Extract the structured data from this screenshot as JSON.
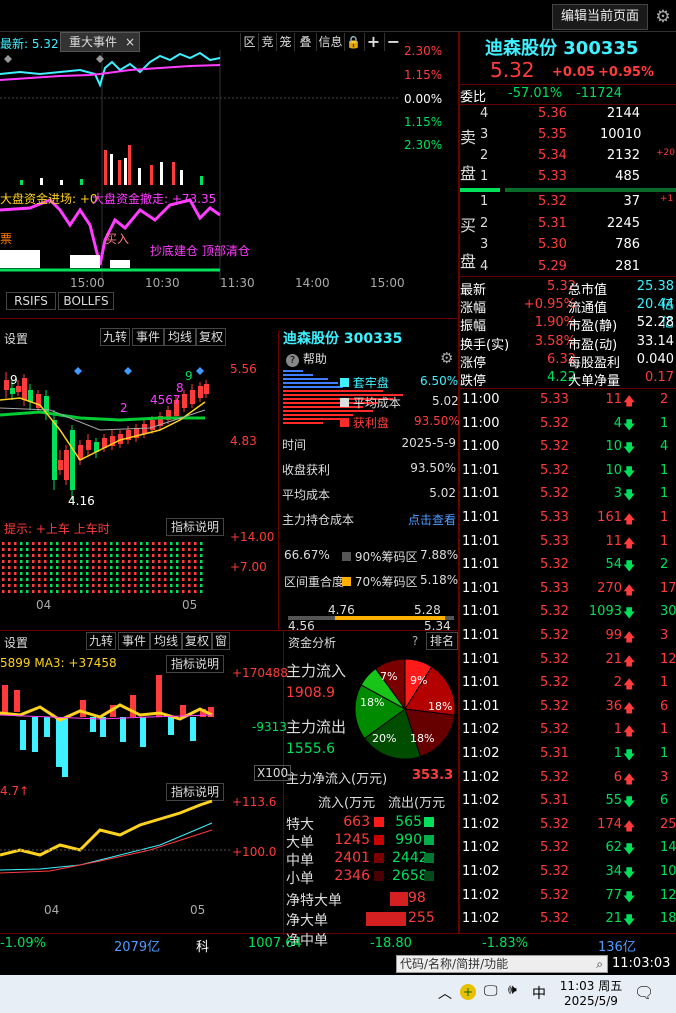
{
  "top": {
    "edit_label": "编辑当前页面"
  },
  "event_tab": {
    "prefix": "最新: 5.32",
    "label": "重大事件",
    "close": "×"
  },
  "chart_toolbar": [
    "区",
    "竞",
    "笼",
    "叠",
    "信息",
    "🔒"
  ],
  "pct_axis": [
    "2.30%",
    "1.15%",
    "0.00%",
    "1.15%",
    "2.30%"
  ],
  "flow_text": {
    "in": "大盘资金进场: +0",
    "out": "大盘资金撤走: +73.35"
  },
  "misc_text": {
    "piao": "票",
    "bottom_line": "抄底建仓  顶部清仓",
    "buy_mark": "买入"
  },
  "time_axis": [
    "15:00",
    "10:30",
    "11:30",
    "14:00",
    "15:00"
  ],
  "indicator_tabs": [
    "RSIFS",
    "BOLLFS"
  ],
  "stock": {
    "name": "迪森股份",
    "code": "300335",
    "price": "5.32",
    "change": "+0.05",
    "change_pct": "+0.95%"
  },
  "weibi": {
    "label": "委比",
    "pct": "-57.01%",
    "diff": "-11724"
  },
  "sell": {
    "label": [
      "卖",
      "盘"
    ],
    "rows": [
      {
        "n": "4",
        "p": "5.36",
        "v": "2144",
        "x": ""
      },
      {
        "n": "3",
        "p": "5.35",
        "v": "10010",
        "x": ""
      },
      {
        "n": "2",
        "p": "5.34",
        "v": "2132",
        "x": "+20"
      },
      {
        "n": "1",
        "p": "5.33",
        "v": "485",
        "x": ""
      }
    ]
  },
  "buy": {
    "label": [
      "买",
      "盘"
    ],
    "rows": [
      {
        "n": "1",
        "p": "5.32",
        "v": "37",
        "x": "+1"
      },
      {
        "n": "2",
        "p": "5.31",
        "v": "2245",
        "x": ""
      },
      {
        "n": "3",
        "p": "5.30",
        "v": "786",
        "x": ""
      },
      {
        "n": "4",
        "p": "5.29",
        "v": "281",
        "x": ""
      }
    ]
  },
  "quote": [
    {
      "l": "最新",
      "v": "5.32",
      "l2": "总市值",
      "v2": "25.38亿"
    },
    {
      "l": "涨幅",
      "v": "+0.95%",
      "l2": "流通值",
      "v2": "20.44亿"
    },
    {
      "l": "振幅",
      "v": "1.90%",
      "l2": "市盈(静)",
      "v2": "52.28"
    },
    {
      "l": "换手(实)",
      "v": "3.58%",
      "l2": "市盈(动)",
      "v2": "33.14"
    },
    {
      "l": "涨停",
      "v": "6.32",
      "l2": "每股盈利",
      "v2": "0.040"
    },
    {
      "l": "跌停",
      "v": "4.22",
      "l2": "大单净量",
      "v2": "0.17"
    }
  ],
  "ticks": [
    {
      "t": "11:00",
      "p": "5.33",
      "v": "11",
      "d": "up",
      "r": "2"
    },
    {
      "t": "11:00",
      "p": "5.32",
      "v": "4",
      "d": "dn",
      "r": "1"
    },
    {
      "t": "11:00",
      "p": "5.32",
      "v": "10",
      "d": "dn",
      "r": "4"
    },
    {
      "t": "11:01",
      "p": "5.32",
      "v": "10",
      "d": "dn",
      "r": "1"
    },
    {
      "t": "11:01",
      "p": "5.32",
      "v": "3",
      "d": "dn",
      "r": "1"
    },
    {
      "t": "11:01",
      "p": "5.33",
      "v": "161",
      "d": "up",
      "r": "1"
    },
    {
      "t": "11:01",
      "p": "5.33",
      "v": "11",
      "d": "up",
      "r": "1"
    },
    {
      "t": "11:01",
      "p": "5.32",
      "v": "54",
      "d": "dn",
      "r": "2"
    },
    {
      "t": "11:01",
      "p": "5.33",
      "v": "270",
      "d": "up",
      "r": "17"
    },
    {
      "t": "11:01",
      "p": "5.32",
      "v": "1093",
      "d": "dn",
      "r": "30"
    },
    {
      "t": "11:01",
      "p": "5.32",
      "v": "99",
      "d": "up",
      "r": "3"
    },
    {
      "t": "11:01",
      "p": "5.32",
      "v": "21",
      "d": "up",
      "r": "12"
    },
    {
      "t": "11:01",
      "p": "5.32",
      "v": "2",
      "d": "up",
      "r": "1"
    },
    {
      "t": "11:01",
      "p": "5.32",
      "v": "36",
      "d": "up",
      "r": "6"
    },
    {
      "t": "11:02",
      "p": "5.32",
      "v": "1",
      "d": "up",
      "r": "1"
    },
    {
      "t": "11:02",
      "p": "5.31",
      "v": "1",
      "d": "dn",
      "r": "1"
    },
    {
      "t": "11:02",
      "p": "5.32",
      "v": "6",
      "d": "up",
      "r": "3"
    },
    {
      "t": "11:02",
      "p": "5.31",
      "v": "55",
      "d": "dn",
      "r": "6"
    },
    {
      "t": "11:02",
      "p": "5.32",
      "v": "174",
      "d": "up",
      "r": "25"
    },
    {
      "t": "11:02",
      "p": "5.32",
      "v": "62",
      "d": "dn",
      "r": "14"
    },
    {
      "t": "11:02",
      "p": "5.32",
      "v": "34",
      "d": "dn",
      "r": "10"
    },
    {
      "t": "11:02",
      "p": "5.32",
      "v": "77",
      "d": "dn",
      "r": "12"
    },
    {
      "t": "11:02",
      "p": "5.32",
      "v": "21",
      "d": "dn",
      "r": "18"
    }
  ],
  "kline_toolbar": {
    "settings": "设置",
    "buttons": [
      "九转",
      "事件",
      "均线",
      "复权"
    ]
  },
  "kline": {
    "high_label": "5.56",
    "mid_label": "4.83",
    "low_value": "4.16",
    "num_labels": [
      "9",
      "8",
      "4567",
      "9",
      "2",
      "9"
    ]
  },
  "hint": {
    "text": "提示: +上车 上车时",
    "explain": "指标说明",
    "ticks": [
      "+14.00",
      "+7.00"
    ],
    "months": [
      "04",
      "05"
    ]
  },
  "help": {
    "title": "帮助",
    "gear": "⚙"
  },
  "chips": {
    "legend": [
      {
        "name": "套牢盘",
        "v": "6.50%"
      },
      {
        "name": "平均成本",
        "v": "5.02"
      },
      {
        "name": "获利盘",
        "v": "93.50%"
      }
    ],
    "rows": [
      {
        "l": "时间",
        "v": "2025-5-9"
      },
      {
        "l": "收盘获利",
        "v": "93.50%"
      },
      {
        "l": "平均成本",
        "v": "5.02"
      },
      {
        "l": "主力持仓成本",
        "v": "点击查看"
      }
    ],
    "concentration": "66.67%",
    "c90": "90%筹码区",
    "c90v": "7.88%",
    "overlap_label": "区间重合度",
    "c70": "70%筹码区",
    "c70v": "5.18%",
    "range_top": [
      "4.76",
      "5.28"
    ],
    "range_bot": [
      "4.56",
      "5.34"
    ]
  },
  "lower_toolbar": {
    "settings": "设置",
    "buttons": [
      "九转",
      "事件",
      "均线",
      "复权",
      "窗"
    ]
  },
  "vol": {
    "label": "5899 MA3: +37458",
    "explain": "指标说明",
    "ticks": [
      "+170488",
      "-9313"
    ],
    "scale": "X100"
  },
  "line2": {
    "label": "4.7↑",
    "explain": "指标说明",
    "ticks": [
      "+113.6",
      "+100.0"
    ],
    "months": [
      "04",
      "05"
    ]
  },
  "fund": {
    "title": "资金分析",
    "help": "?",
    "rank": "排名",
    "in_label": "主力流入",
    "in_value": "1908.9",
    "out_label": "主力流出",
    "out_value": "1555.6",
    "net_label": "主力净流入(万元)",
    "net_value": "353.3",
    "table_head": [
      "流入(万元",
      "流出(万元"
    ],
    "pie": [
      {
        "v": 9,
        "c": "#ff1a1a"
      },
      {
        "v": 18,
        "c": "#b30000"
      },
      {
        "v": 18,
        "c": "#660000"
      },
      {
        "v": 20,
        "c": "#004d00"
      },
      {
        "v": 18,
        "c": "#008a00"
      },
      {
        "v": 7,
        "c": "#19c419"
      },
      {
        "v": 10,
        "c": "#7a0000"
      }
    ],
    "pie_labels": [
      "9%",
      "18%",
      "18%",
      "20%",
      "18%",
      "7%"
    ],
    "rows": [
      {
        "l": "特大",
        "in": "663",
        "out": "565"
      },
      {
        "l": "大单",
        "in": "1245",
        "out": "990"
      },
      {
        "l": "中单",
        "in": "2401",
        "out": "2442"
      },
      {
        "l": "小单",
        "in": "2346",
        "out": "2658"
      }
    ],
    "net_rows": [
      {
        "l": "净特大单",
        "v": "98"
      },
      {
        "l": "净大单",
        "v": "255"
      },
      {
        "l": "净中单",
        "v": ""
      }
    ]
  },
  "status": {
    "a": "-1.09%",
    "b": "2079亿",
    "c": "科",
    "d": "1007.64",
    "e": "-18.80",
    "f": "-1.83%",
    "g": "136亿"
  },
  "search": {
    "placeholder": "代码/名称/简拼/功能",
    "clock": "11:03:03"
  },
  "taskbar": {
    "time": "11:03 周五",
    "date": "2025/5/9",
    "ime": "中"
  },
  "colors": {
    "up": "#ff3b3b",
    "down": "#00e05a",
    "bg": "#000000",
    "panel_line": "#6a0000"
  }
}
